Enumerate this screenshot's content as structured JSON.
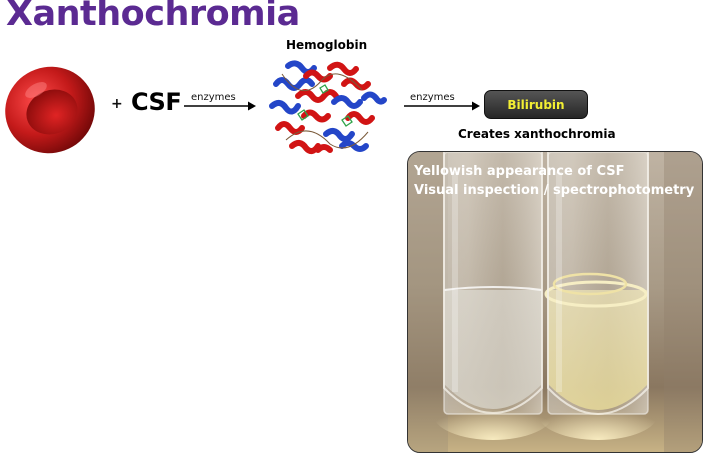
{
  "title": "Xanthochromia",
  "plus": "+",
  "csf": "CSF",
  "arrow1_label": "enzymes",
  "arrow2_label": "enzymes",
  "hemoglobin_label": "Hemoglobin",
  "bilirubin_label": "Bilirubin",
  "creates_caption": "Creates xanthochromia",
  "photo": {
    "line1": "Yellowish appearance of CSF",
    "line2": "Visual inspection / spectrophotometry"
  },
  "colors": {
    "title": "#5b2a92",
    "rbc": "#c41a1a",
    "bilirubin_text": "#f3ef33",
    "bilirubin_box": "#2f2f2f",
    "helix_red": "#d11414",
    "helix_blue": "#2446c8"
  }
}
